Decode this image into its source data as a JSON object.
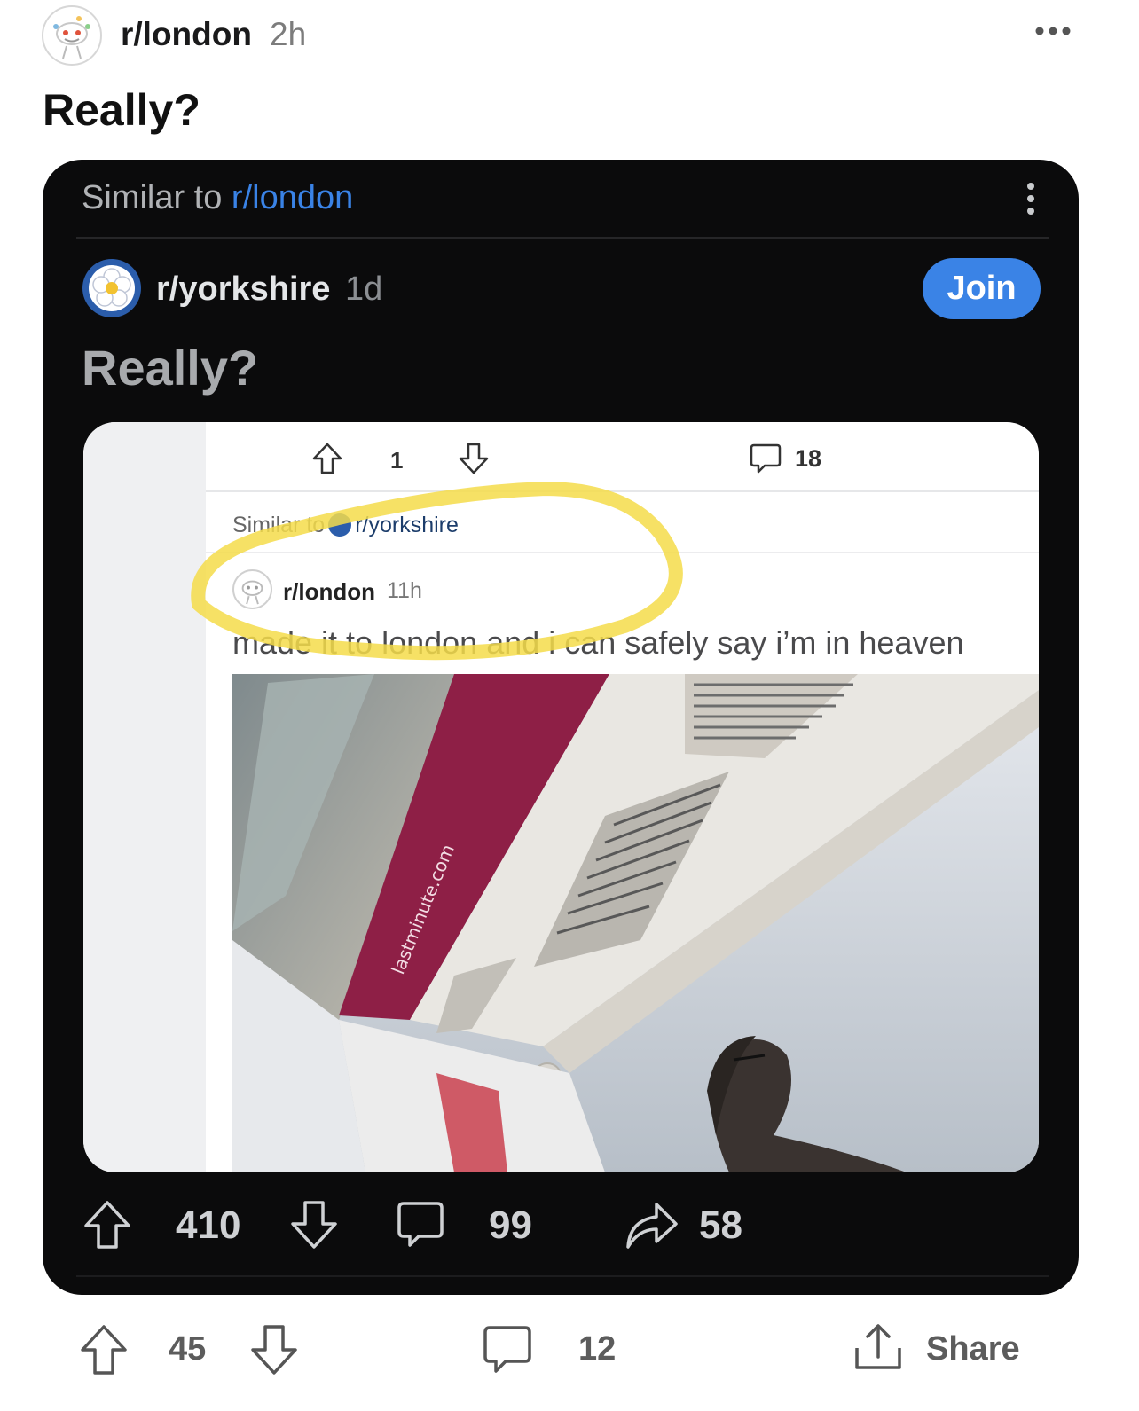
{
  "post": {
    "subreddit": "r/london",
    "time": "2h",
    "title": "Really?",
    "score": "45",
    "comments": "12",
    "share_label": "Share"
  },
  "embedded": {
    "similar_prefix": "Similar to ",
    "similar_link": "r/london",
    "subreddit": "r/yorkshire",
    "time": "1d",
    "join_label": "Join",
    "title": "Really?",
    "score": "410",
    "comments": "99",
    "shares": "58",
    "screenshot": {
      "score": "1",
      "comments": "18",
      "similar_prefix": "Similar to",
      "similar_link": "r/yorkshire",
      "subreddit": "r/london",
      "time": "11h",
      "title": "made it to london and i can safely say i’m in heaven",
      "banner_text": "lastminute.com"
    }
  },
  "colors": {
    "accent": "#3a83e6",
    "card_bg": "#0b0b0c",
    "highlight": "#f4dc4a",
    "banner": "#8e1f46"
  },
  "icons": [
    "reddit-snoo-icon",
    "more-options-icon",
    "yorkshire-rose-icon",
    "upvote-icon",
    "downvote-icon",
    "comment-icon",
    "share-arrow-icon",
    "share-icon"
  ]
}
